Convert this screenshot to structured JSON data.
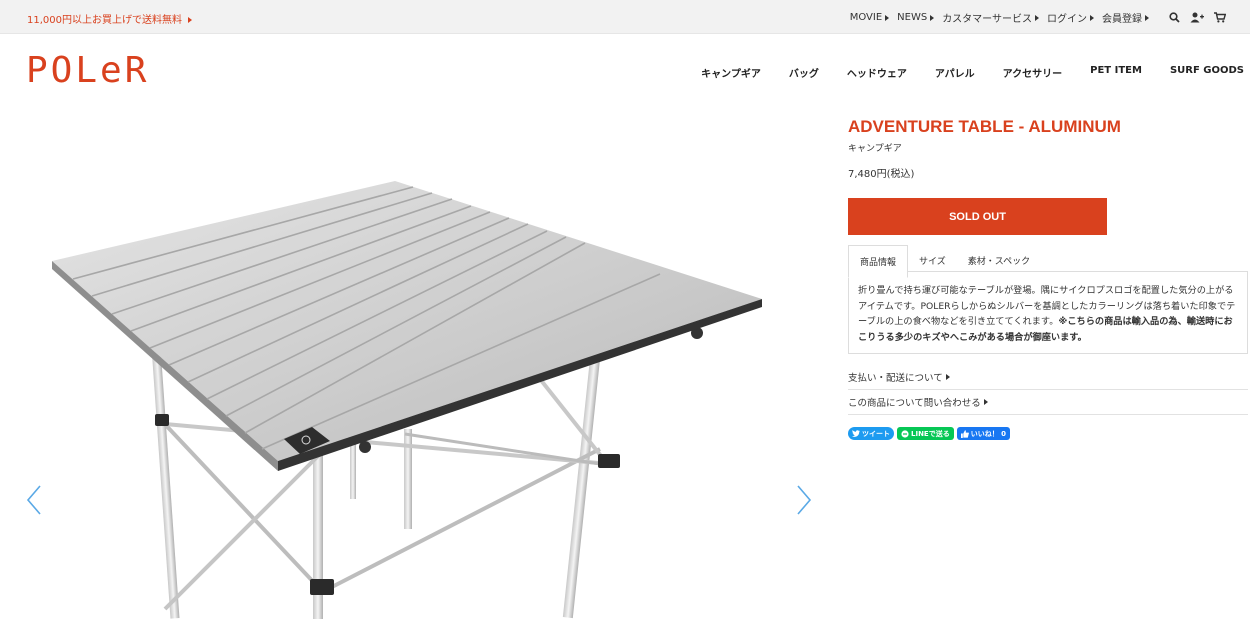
{
  "topbar": {
    "promo": "11,000円以上お買上げで送料無料",
    "links": [
      "MOVIE",
      "NEWS",
      "カスタマーサービス",
      "ログイン",
      "会員登録"
    ],
    "icons": [
      "search-icon",
      "user-add-icon",
      "cart-icon"
    ]
  },
  "header": {
    "logo": "POLeR",
    "nav": [
      "キャンプギア",
      "バッグ",
      "ヘッドウェア",
      "アパレル",
      "アクセサリー",
      "PET ITEM",
      "SURF GOODS"
    ]
  },
  "product": {
    "title": "ADVENTURE TABLE - ALUMINUM",
    "category": "キャンプギア",
    "price": "7,480円(税込)",
    "button": "SOLD OUT",
    "tabs": [
      "商品情報",
      "サイズ",
      "素材・スペック"
    ],
    "active_tab": 0,
    "description": "折り畳んで持ち運び可能なテーブルが登場。隅にサイクロプスロゴを配置した気分の上がるアイテムです。POLERらしからぬシルバーを基調としたカラーリングは落ち着いた印象でテーブルの上の食べ物などを引き立ててくれます。",
    "notice": "※こちらの商品は輸入品の為、輸送時におこりうる多少のキズやへこみがある場合が御座います。",
    "links": [
      "支払い・配送について",
      "この商品について問い合わせる"
    ]
  },
  "social": {
    "tweet": "ツイート",
    "line": "LINEで送る",
    "like": "いいね！ 0"
  },
  "colors": {
    "accent": "#d9411e",
    "arrow": "#5aa9e6",
    "twitter": "#1d9bf0",
    "line": "#06c755",
    "facebook": "#1877f2"
  }
}
